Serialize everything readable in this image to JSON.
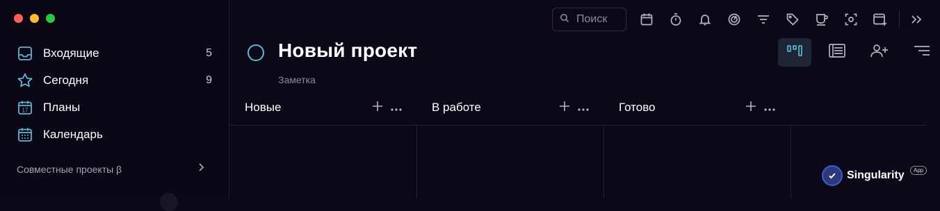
{
  "sidebar": {
    "items": [
      {
        "label": "Входящие",
        "count": "5",
        "icon": "inbox-icon"
      },
      {
        "label": "Сегодня",
        "count": "9",
        "icon": "star-icon"
      },
      {
        "label": "Планы",
        "count": "",
        "icon": "calendar-17-icon",
        "icon_text": "17"
      },
      {
        "label": "Календарь",
        "count": "",
        "icon": "calendar-grid-icon"
      }
    ],
    "shared_projects": "Совместные проекты β"
  },
  "toolbar": {
    "search_placeholder": "Поиск",
    "icons": [
      "calendar-icon",
      "stopwatch-icon",
      "bell-icon",
      "focus-icon",
      "filter-icon",
      "tag-icon",
      "coffee-icon",
      "capture-icon",
      "new-window-icon",
      "expand-icon"
    ]
  },
  "project": {
    "title": "Новый проект",
    "note": "Заметка"
  },
  "view_toggles": [
    "board-view-icon",
    "list-view-icon",
    "share-user-icon",
    "sort-icon"
  ],
  "board": {
    "columns": [
      {
        "title": "Новые"
      },
      {
        "title": "В работе"
      },
      {
        "title": "Готово"
      }
    ]
  },
  "brand": {
    "name": "Singularity",
    "badge": "App"
  },
  "colors": {
    "background": "#0d0818",
    "sidebar": "#0b0715",
    "accent": "#5cb7d9",
    "text": "#ffffff",
    "muted": "#8e8999"
  }
}
